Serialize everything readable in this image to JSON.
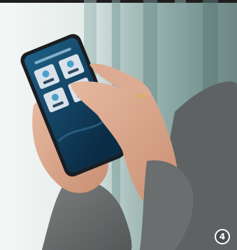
{
  "photo": {
    "subject": "hand-holding-smartphone-with-app",
    "step_number": "4"
  },
  "app_screen": {
    "title": "",
    "tiles": [
      {
        "icon": "appliance-icon"
      },
      {
        "icon": "appliance-icon"
      },
      {
        "icon": "appliance-icon"
      },
      {
        "icon": "appliance-icon"
      }
    ]
  },
  "colors": {
    "screen_bg": "#0d3a5a",
    "tile_bg": "#d9e2ea",
    "accent": "#4a9fc9",
    "curtain": "#8aa8a6",
    "window_light": "#eef3f1",
    "sweater": "#6f7272",
    "skin": "#d9a58a"
  }
}
